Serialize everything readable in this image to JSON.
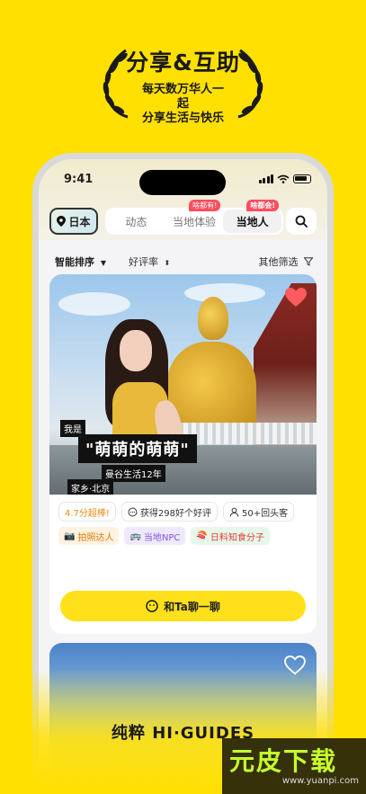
{
  "hero": {
    "title": "分享&互助",
    "line1": "每天数万华人一",
    "line2": "起",
    "line3": "分享生活与快乐"
  },
  "status_bar": {
    "time": "9:41"
  },
  "top_bar": {
    "country": "日本",
    "tabs": [
      {
        "label": "动态",
        "badge": ""
      },
      {
        "label": "当地体验",
        "badge": "啥都有!"
      },
      {
        "label": "当地人",
        "badge": "啥都会!"
      }
    ],
    "active_tab": "当地人",
    "search_icon": "search-icon"
  },
  "filters": {
    "sort": "智能排序",
    "rating": "好评率",
    "other": "其他筛选"
  },
  "card": {
    "intro_label": "我是",
    "nickname": "\"萌萌的萌萌\"",
    "life_tag": "曼谷生活12年",
    "hometown": "家乡·北京",
    "stats": [
      {
        "text": "4.7分超棒!",
        "icon": ""
      },
      {
        "text": "获得298好个好评",
        "icon": "message-icon"
      },
      {
        "text": "50+回头客",
        "icon": "person-icon"
      }
    ],
    "tags": [
      {
        "text": "拍照达人",
        "icon": "camera-icon"
      },
      {
        "text": "当地NPC",
        "icon": "bus-icon"
      },
      {
        "text": "日料知食分子",
        "icon": "sushi-icon"
      }
    ],
    "chat_label": "和Ta聊一聊"
  },
  "brand": "纯粹 HI·GUIDES",
  "watermark": {
    "main": "元皮下载",
    "url": "www.yuanpi.com"
  },
  "colors": {
    "brand_yellow": "#FFE000",
    "heart_red": "#ff5a5f"
  }
}
